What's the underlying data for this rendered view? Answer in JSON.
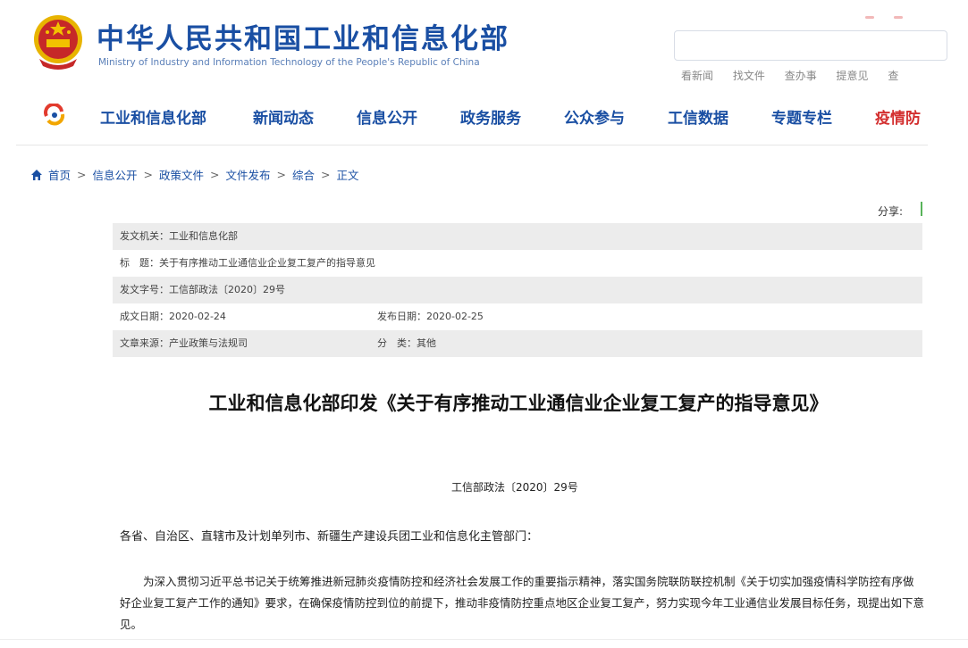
{
  "header": {
    "title": "中华人民共和国工业和信息化部",
    "subtitle": "Ministry of Industry and Information Technology of the People's Republic of China",
    "search": {
      "placeholder": ""
    },
    "quick_links": [
      "看新闻",
      "找文件",
      "查办事",
      "提意见",
      "查"
    ]
  },
  "nav": {
    "items": [
      "工业和信息化部",
      "新闻动态",
      "信息公开",
      "政务服务",
      "公众参与",
      "工信数据",
      "专题专栏",
      "疫情防"
    ]
  },
  "breadcrumb": {
    "items": [
      "首页",
      "信息公开",
      "政策文件",
      "文件发布",
      "综合",
      "正文"
    ],
    "separator": ">"
  },
  "share_label": "分享:",
  "meta": {
    "issuer": "发文机关：工业和信息化部",
    "title": "标　题：关于有序推动工业通信业企业复工复产的指导意见",
    "doc_number": "发文字号：工信部政法〔2020〕29号",
    "written_date": "成文日期：2020-02-24",
    "publish_date": "发布日期：2020-02-25",
    "source": "文章来源：产业政策与法规司",
    "category": "分　类：其他"
  },
  "article": {
    "title": "工业和信息化部印发《关于有序推动工业通信业企业复工复产的指导意见》",
    "doc_number": "工信部政法〔2020〕29号",
    "addressee": "各省、自治区、直辖市及计划单列市、新疆生产建设兵团工业和信息化主管部门：",
    "paragraph": "为深入贯彻习近平总书记关于统筹推进新冠肺炎疫情防控和经济社会发展工作的重要指示精神，落实国务院联防联控机制《关于切实加强疫情科学防控有序做好企业复工复产工作的通知》要求，在确保疫情防控到位的前提下，推动非疫情防控重点地区企业复工复产，努力实现今年工业通信业发展目标任务，现提出如下意见。"
  },
  "colors": {
    "brand_blue": "#1a4fa3",
    "accent_red": "#d32f2f",
    "emblem_red": "#c62828",
    "emblem_gold": "#f2c200"
  },
  "icons": {
    "emblem": "national-emblem-icon",
    "nav_logo": "miit-logo-icon",
    "home": "home-icon"
  }
}
